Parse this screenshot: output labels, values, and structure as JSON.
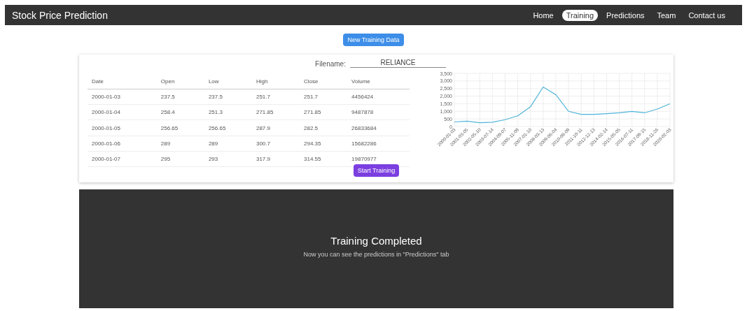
{
  "navbar": {
    "brand": "Stock Price Prediction",
    "links": [
      {
        "label": "Home",
        "selected": false
      },
      {
        "label": "Training",
        "selected": true
      },
      {
        "label": "Predictions",
        "selected": false
      },
      {
        "label": "Team",
        "selected": false
      },
      {
        "label": "Contact us",
        "selected": false
      }
    ]
  },
  "new_data_button": "New Training Data",
  "filename": {
    "label": "Filename:",
    "value": "RELIANCE"
  },
  "table": {
    "columns": [
      "Date",
      "Open",
      "Low",
      "High",
      "Close",
      "Volume"
    ],
    "rows": [
      [
        "2000-01-03",
        "237.5",
        "237.5",
        "251.7",
        "251.7",
        "4456424"
      ],
      [
        "2000-01-04",
        "258.4",
        "251.3",
        "271.85",
        "271.85",
        "9487878"
      ],
      [
        "2000-01-05",
        "256.65",
        "256.65",
        "287.9",
        "282.5",
        "26833684"
      ],
      [
        "2000-01-06",
        "289",
        "289",
        "300.7",
        "294.35",
        "15682286"
      ],
      [
        "2000-01-07",
        "295",
        "293",
        "317.9",
        "314.55",
        "19870977"
      ]
    ]
  },
  "chart_data": {
    "type": "line",
    "categories": [
      "2000-01-03",
      "2001-03-05",
      "2002-05-10",
      "2003-07-14",
      "2004-09-07",
      "2005-11-09",
      "2007-01-10",
      "2008-03-13",
      "2009-06-04",
      "2010-08-09",
      "2011-10-11",
      "2012-12-13",
      "2014-02-14",
      "2015-05-05",
      "2016-07-11",
      "2017-09-15",
      "2018-11-26",
      "2020-02-03"
    ],
    "grid": true,
    "series": [
      {
        "color": "#4fb3d9",
        "values": [
          300,
          350,
          250,
          280,
          450,
          700,
          1300,
          2600,
          2100,
          1000,
          800,
          800,
          850,
          900,
          1000,
          900,
          1150,
          1500
        ]
      }
    ],
    "ylim": [
      0,
      3500
    ],
    "yticks": [
      0,
      {
        "value": 500,
        "label": "500"
      },
      {
        "value": 1000,
        "label": "1,000"
      },
      {
        "value": 1500,
        "label": "1,500"
      },
      {
        "value": 2000,
        "label": "2,000"
      },
      {
        "value": 2500,
        "label": "2,500"
      },
      {
        "value": 3000,
        "label": "3,000"
      },
      {
        "value": 3500,
        "label": "3,500"
      }
    ]
  },
  "start_button": "Start Training",
  "result": {
    "title": "Training Completed",
    "message": "Now you can see the predictions in \"Predictions\" tab"
  }
}
